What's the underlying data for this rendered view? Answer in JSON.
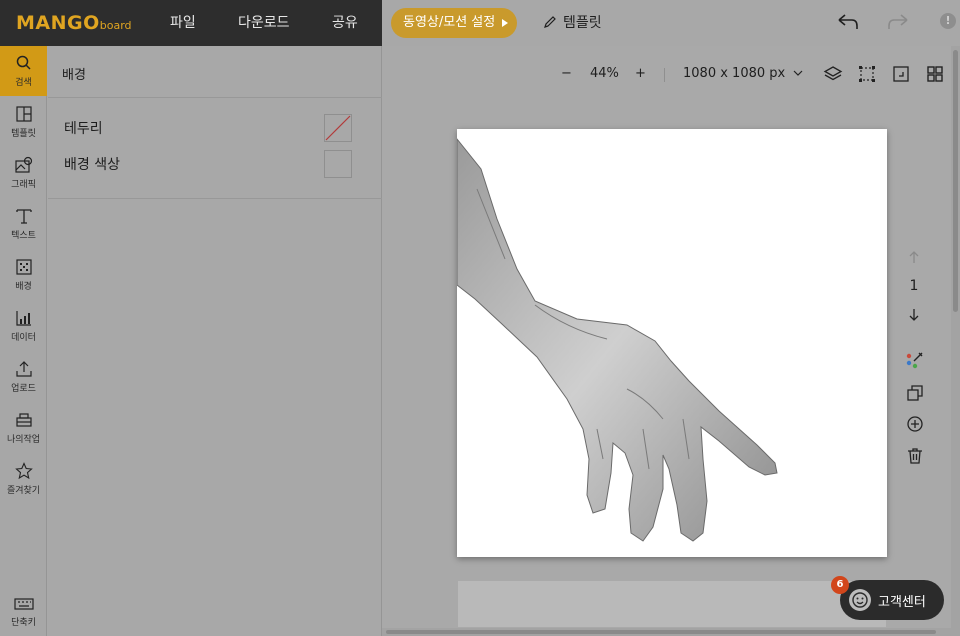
{
  "app": {
    "logo_main": "MANGO",
    "logo_sub": "board"
  },
  "menu": {
    "file": "파일",
    "download": "다운로드",
    "share": "공유"
  },
  "motion_button": "동영상/모션 설정",
  "template_button": "템플릿",
  "rail": [
    {
      "label": "검색",
      "icon": "search-icon"
    },
    {
      "label": "템플릿",
      "icon": "template-icon"
    },
    {
      "label": "그래픽",
      "icon": "graphic-icon"
    },
    {
      "label": "텍스트",
      "icon": "text-icon"
    },
    {
      "label": "배경",
      "icon": "background-icon"
    },
    {
      "label": "데이터",
      "icon": "chart-icon"
    },
    {
      "label": "업로드",
      "icon": "upload-icon"
    },
    {
      "label": "나의작업",
      "icon": "my-work-icon"
    },
    {
      "label": "즐겨찾기",
      "icon": "star-icon"
    },
    {
      "label": "단축키",
      "icon": "keyboard-icon"
    }
  ],
  "panel": {
    "title": "배경",
    "border_label": "테두리",
    "bg_color_label": "배경 색상"
  },
  "toolbar": {
    "zoom_minus": "−",
    "zoom_value": "44%",
    "zoom_plus": "+",
    "canvas_size": "1080 x 1080 px"
  },
  "page_nav": {
    "page_number": "1"
  },
  "help": {
    "label": "고객센터",
    "badge": "6"
  },
  "colors": {
    "brand": "#d29a16",
    "topbar_dark": "#2d2d2d",
    "badge": "#d2461b"
  }
}
